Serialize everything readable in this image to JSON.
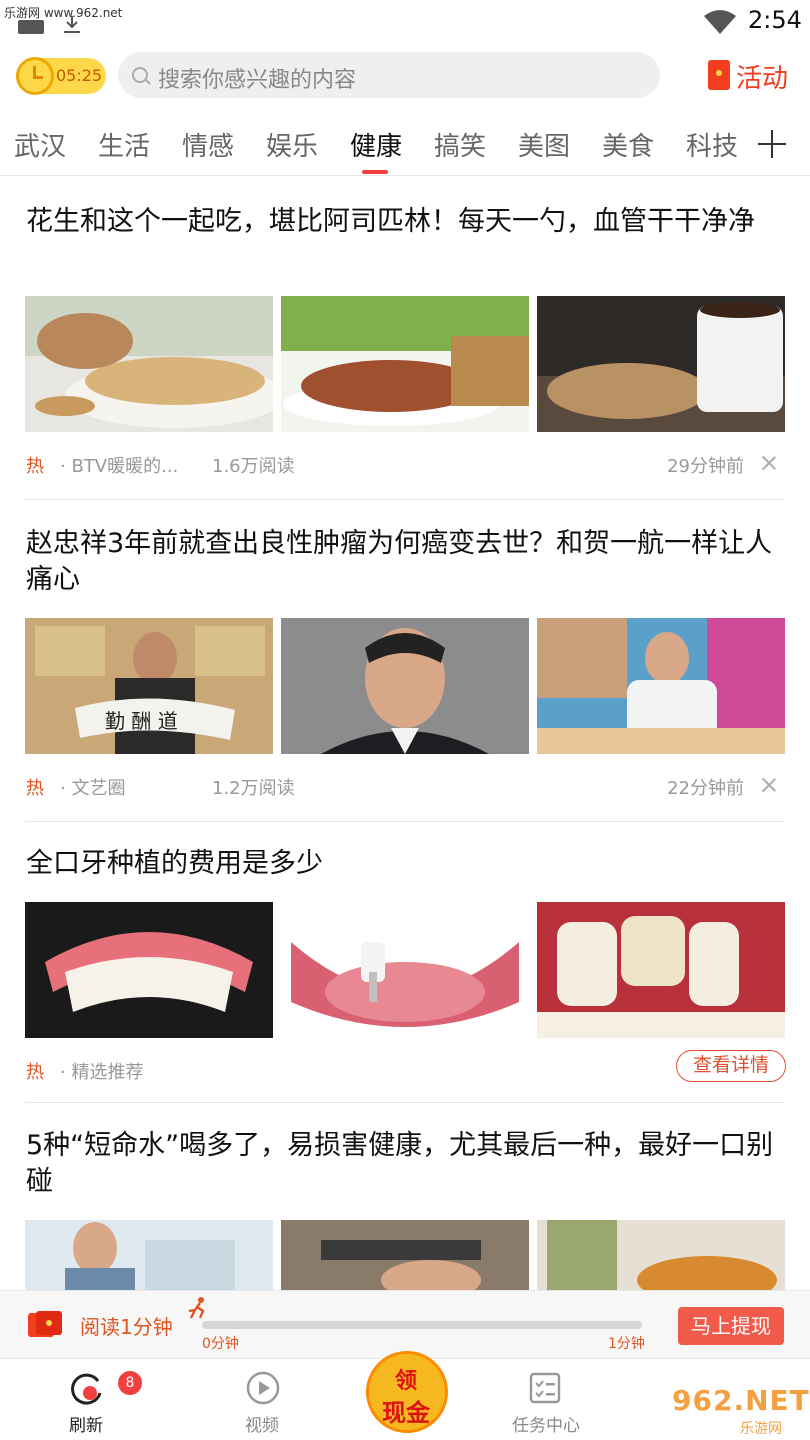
{
  "status_bar": {
    "watermark": "乐游网 www.962.net",
    "time": "2:54"
  },
  "header": {
    "timer": "05:25",
    "search_placeholder": "搜索你感兴趣的内容",
    "activity_label": "活动"
  },
  "tabs": [
    "武汉",
    "生活",
    "情感",
    "娱乐",
    "健康",
    "搞笑",
    "美图",
    "美食",
    "科技"
  ],
  "active_tab": "健康",
  "articles": [
    {
      "title": "花生和这个一起吃，堪比阿司匹林！每天一勺，血管干干净净",
      "tag": "热",
      "source": "· BTV暖暖的...",
      "reads": "1.6万阅读",
      "time": "29分钟前"
    },
    {
      "title": "赵忠祥3年前就查出良性肿瘤为何癌变去世？和贺一航一样让人痛心",
      "tag": "热",
      "source": "· 文艺圈",
      "reads": "1.2万阅读",
      "time": "22分钟前"
    },
    {
      "title": "全口牙种植的费用是多少",
      "tag": "热",
      "source": "· 精选推荐",
      "detail_button": "查看详情"
    },
    {
      "title": "5种“短命水”喝多了，易损害健康，尤其最后一种，最好一口别碰"
    }
  ],
  "reading_bar": {
    "label": "阅读1分钟",
    "start_label": "0分钟",
    "end_label": "1分钟",
    "progress": 0,
    "withdraw_label": "马上提现"
  },
  "bottom_nav": {
    "refresh": "刷新",
    "refresh_badge": "8",
    "video": "视频",
    "cash_line1": "领",
    "cash_line2": "现金",
    "tasks": "任务中心"
  },
  "site_watermark": {
    "line1": "962.NET",
    "line2": "乐游网"
  },
  "colors": {
    "accent": "#f04040",
    "hot": "#e0541f",
    "timer_bg": "#ffd84a"
  }
}
